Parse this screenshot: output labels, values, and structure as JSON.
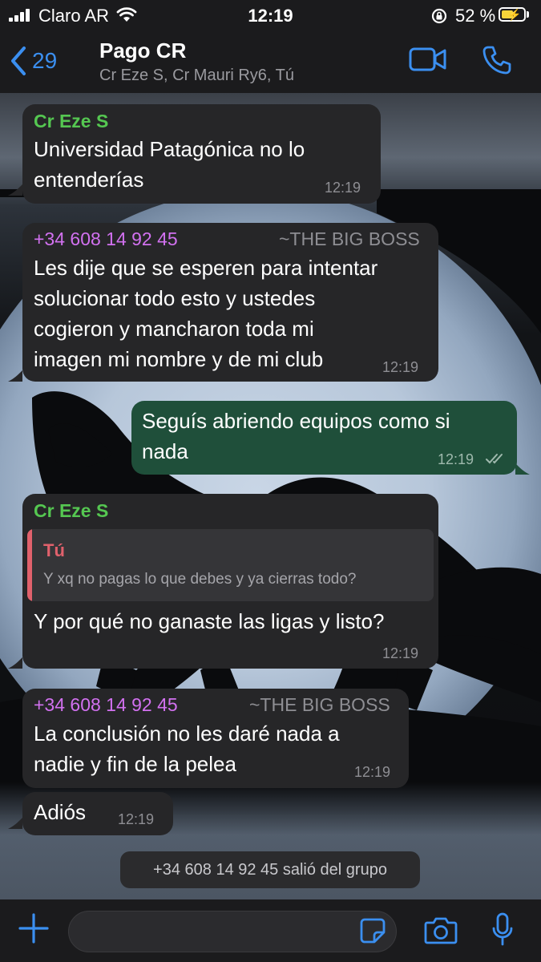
{
  "status_bar": {
    "carrier": "Claro AR",
    "time": "12:19",
    "battery_percent": "52 %",
    "battery_level": 0.52,
    "battery_fill_color": "#f5d43a",
    "icons": [
      "signal-icon",
      "wifi-icon",
      "orientation-lock-icon",
      "battery-icon",
      "charging-bolt-icon"
    ]
  },
  "header": {
    "back_count": "29",
    "title": "Pago CR",
    "participants": "Cr Eze S, Cr Mauri Ry6, Tú",
    "accent_color": "#3b8ff0",
    "icons": [
      "chevron-left-icon",
      "video-call-icon",
      "phone-call-icon"
    ]
  },
  "messages": [
    {
      "sender": "Cr Eze S",
      "text_lines": [
        "Universidad Patagónica no lo",
        "entenderías"
      ],
      "time": "12:19"
    },
    {
      "sender": "+34 608 14 92 45",
      "alias": "~THE BIG BOSS",
      "text_lines": [
        "Les dije que se esperen para intentar",
        "solucionar todo esto y ustedes",
        "cogieron y mancharon toda mi",
        "imagen mi nombre y de mi club"
      ],
      "time": "12:19"
    },
    {
      "outgoing": true,
      "text_lines": [
        "Seguís abriendo equipos como si",
        "nada"
      ],
      "time": "12:19",
      "status_icon": "double-check-icon"
    },
    {
      "sender": "Cr Eze S",
      "quote": {
        "name": "Tú",
        "text": "Y xq no pagas lo que debes y ya cierras todo?"
      },
      "text_lines": [
        "Y por qué no ganaste las ligas y listo?"
      ],
      "time": "12:19"
    },
    {
      "sender": "+34 608 14 92 45",
      "alias": "~THE BIG BOSS",
      "text_lines": [
        "La conclusión no les daré nada a",
        "nadie y fin de la pelea"
      ],
      "time": "12:19"
    },
    {
      "text_lines": [
        "Adiós"
      ],
      "time": "12:19"
    }
  ],
  "system_message": "+34 608 14 92 45 salió del grupo",
  "input_bar": {
    "icons": [
      "plus-icon",
      "sticker-icon",
      "camera-icon",
      "microphone-icon"
    ]
  }
}
